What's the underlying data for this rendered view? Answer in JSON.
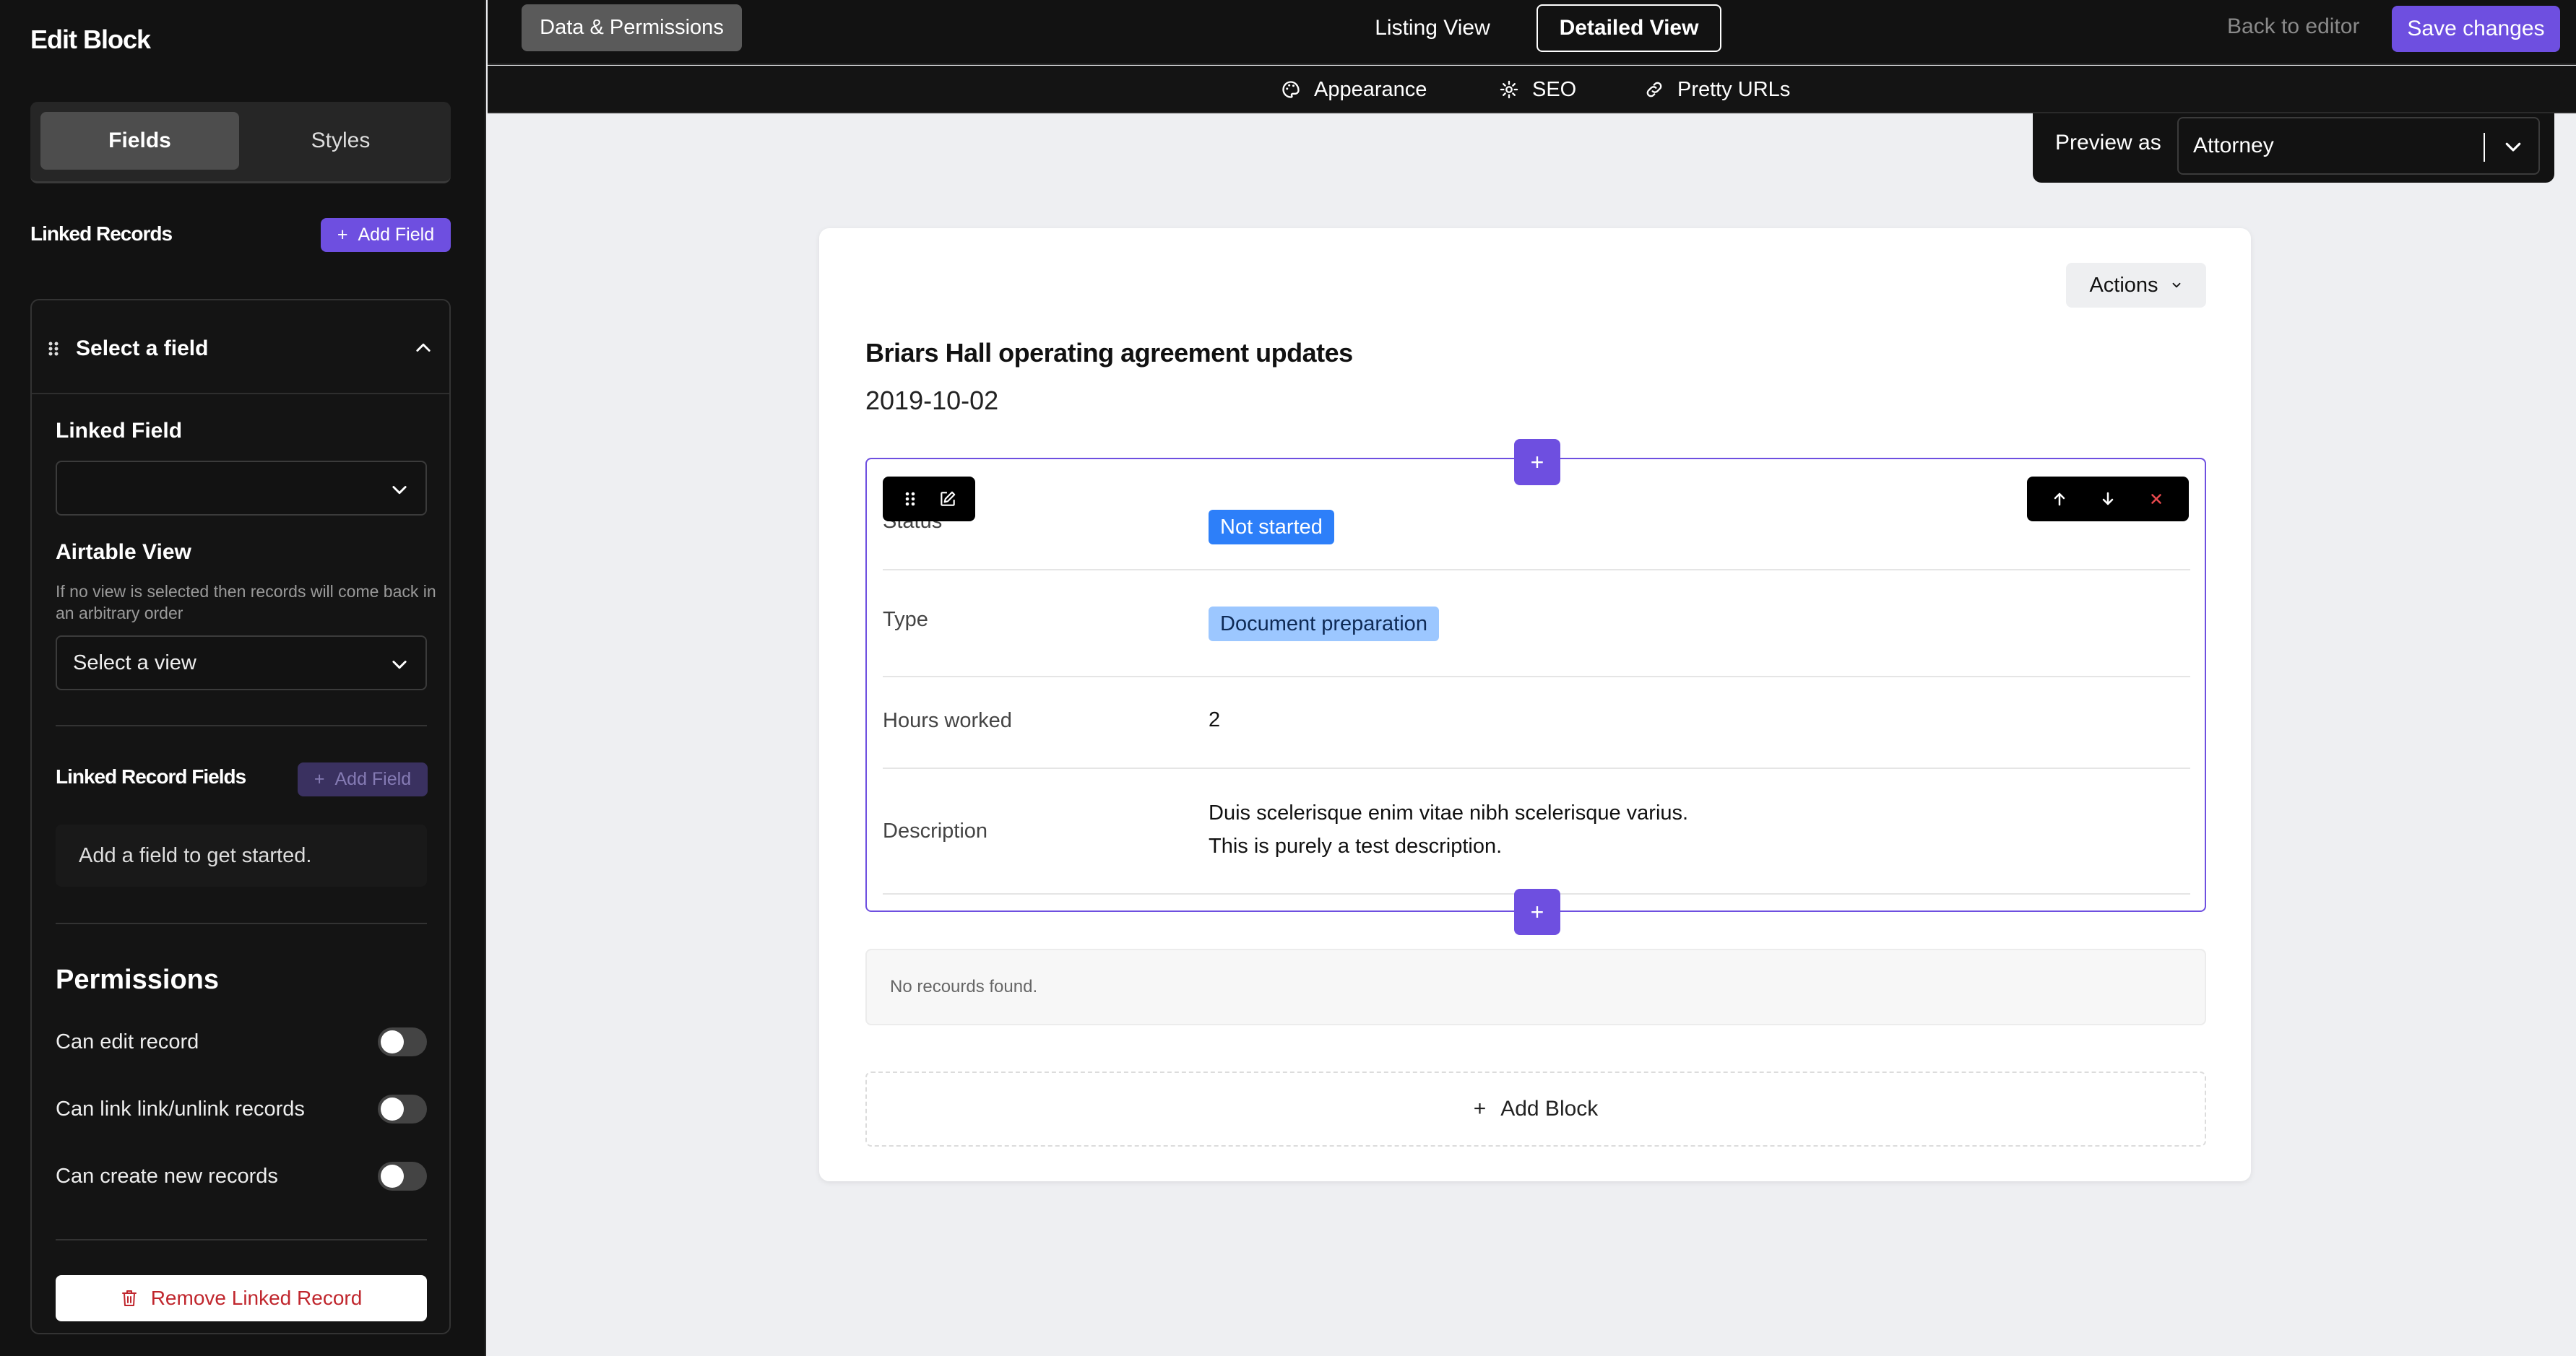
{
  "sidebar": {
    "title": "Edit Block",
    "tabs": [
      {
        "label": "Fields",
        "active": true
      },
      {
        "label": "Styles",
        "active": false
      }
    ],
    "linked_records_label": "Linked Records",
    "add_field_label": "Add Field",
    "field_card": {
      "title": "Select a field",
      "linked_field_label": "Linked Field",
      "linked_field_value": "",
      "airtable_view_label": "Airtable View",
      "airtable_view_help": "If no view is selected then records will come back in an arbitrary order",
      "airtable_view_value": "Select a view",
      "linked_record_fields_label": "Linked Record Fields",
      "linked_record_add_label": "Add Field",
      "empty_message": "Add a field to get started.",
      "permissions_title": "Permissions",
      "permissions": [
        {
          "label": "Can edit record",
          "enabled": false
        },
        {
          "label": "Can link link/unlink records",
          "enabled": false
        },
        {
          "label": "Can create new records",
          "enabled": false
        }
      ],
      "remove_label": "Remove Linked Record"
    }
  },
  "topbar": {
    "data_permissions_label": "Data & Permissions",
    "views": [
      {
        "label": "Listing View",
        "active": false
      },
      {
        "label": "Detailed View",
        "active": true
      }
    ],
    "back_label": "Back to editor",
    "save_label": "Save changes"
  },
  "subbar": {
    "items": [
      {
        "label": "Appearance",
        "icon": "palette-icon"
      },
      {
        "label": "SEO",
        "icon": "gear-icon"
      },
      {
        "label": "Pretty URLs",
        "icon": "link-icon"
      }
    ]
  },
  "preview": {
    "label": "Preview as",
    "value": "Attorney"
  },
  "record": {
    "actions_label": "Actions",
    "title": "Briars Hall operating agreement updates",
    "date": "2019-10-02",
    "fields": [
      {
        "label": "Status",
        "value": "Not started",
        "kind": "badge-blue"
      },
      {
        "label": "Type",
        "value": "Document preparation",
        "kind": "badge-light"
      },
      {
        "label": "Hours worked",
        "value": "2",
        "kind": "text"
      },
      {
        "label": "Description",
        "value_lines": [
          "Duis scelerisque enim vitae nibh scelerisque varius.",
          "This is purely a test description."
        ],
        "kind": "text"
      }
    ],
    "no_records_message": "No recourds found.",
    "add_block_label": "Add Block"
  },
  "colors": {
    "accent": "#6e4fe0",
    "status_badge": "#2d7ff9",
    "type_badge": "#9cc7ff",
    "danger": "#c0262d"
  }
}
